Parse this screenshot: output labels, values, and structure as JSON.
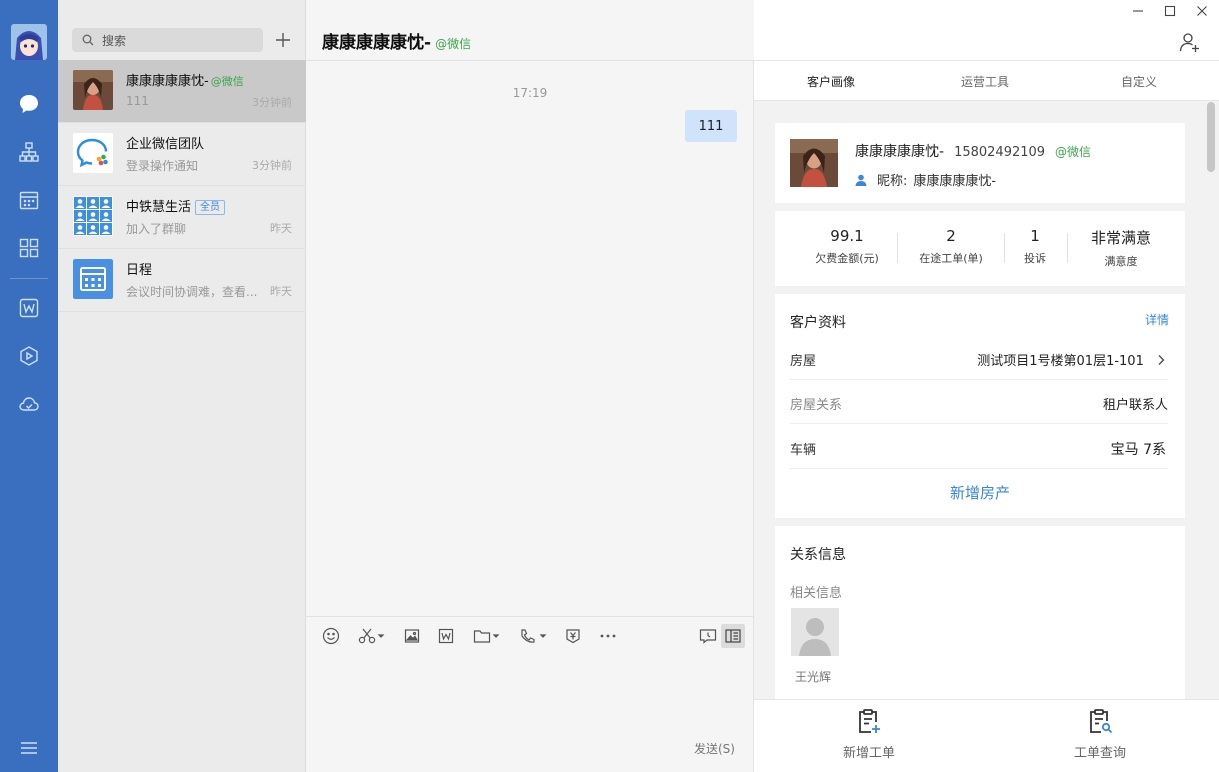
{
  "sidebar": {
    "icons": [
      "chat-icon",
      "org-icon",
      "calendar-icon",
      "apps-icon",
      "doc-icon",
      "cube-icon",
      "cloud-icon",
      "menu-icon"
    ],
    "colors": {
      "bg": "#3a6fbf"
    }
  },
  "search": {
    "placeholder": "搜索"
  },
  "conversations": [
    {
      "name": "康康康康康忱-",
      "tag": "@微信",
      "preview": "111",
      "time": "3分钟前",
      "active": true
    },
    {
      "name": "企业微信团队",
      "preview": "登录操作通知",
      "time": "3分钟前"
    },
    {
      "name": "中铁慧生活",
      "badge": "全员",
      "preview": "加入了群聊",
      "time": "昨天"
    },
    {
      "name": "日程",
      "preview": "会议时间协调难，查看...",
      "time": "昨天"
    }
  ],
  "chat": {
    "title": "康康康康康忱-",
    "tag": "@微信",
    "timestamp": "17:19",
    "message": "111",
    "send_label": "发送(S)"
  },
  "panel": {
    "tabs": [
      "客户画像",
      "运营工具",
      "自定义"
    ],
    "profile": {
      "name": "康康康康康忱-",
      "phone": "15802492109",
      "tag": "@微信",
      "nick_label": "昵称:",
      "nick": "康康康康康忱-"
    },
    "stats": [
      {
        "value": "99.1",
        "label": "欠费金额(元)"
      },
      {
        "value": "2",
        "label": "在途工单(单)"
      },
      {
        "value": "1",
        "label": "投诉"
      },
      {
        "value": "非常满意",
        "label": "满意度"
      }
    ],
    "info": {
      "title": "客户资料",
      "detail": "详情",
      "rows": [
        {
          "key": "房屋",
          "value": "测试项目1号楼第01层1-101"
        },
        {
          "key": "房屋关系",
          "value": "租户联系人"
        },
        {
          "key": "车辆",
          "value": "宝马 7系"
        }
      ],
      "add_house": "新增房产"
    },
    "relation": {
      "title": "关系信息",
      "sub": "相关信息",
      "person": "王光辉"
    },
    "bottom": [
      {
        "label": "新增工单"
      },
      {
        "label": "工单查询"
      }
    ]
  },
  "colors": {
    "accent": "#3a86d8",
    "wechat_green": "#3fa34d",
    "bubble": "#cfe3fb"
  }
}
